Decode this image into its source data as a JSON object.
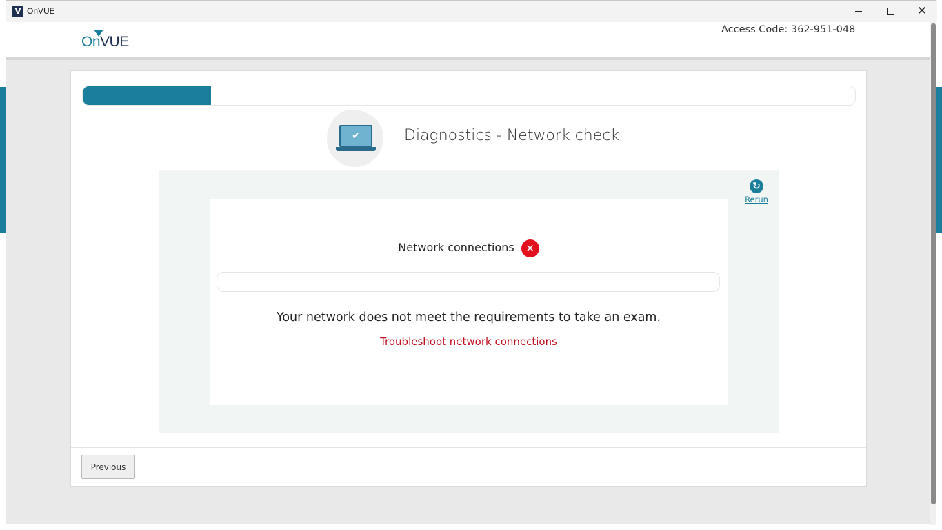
{
  "window": {
    "title": "OnVUE",
    "icon_letter": "V",
    "controls": [
      "minimize-icon",
      "maximize-icon",
      "close-icon"
    ],
    "close_glyph": "✕"
  },
  "header": {
    "logo_on": "On",
    "logo_vue": "VUE",
    "access_code": "Access Code: 362-951-048"
  },
  "progress": {
    "fraction": 0.166
  },
  "step": {
    "title": "Diagnostics - Network check",
    "icon": "laptop-check-icon"
  },
  "check": {
    "rerun_label": "Rerun",
    "label": "Network connections",
    "status": "failed",
    "status_glyph": "✕",
    "message": "Your network does not meet the requirements to take an exam.",
    "link_text": "Troubleshoot network connections"
  },
  "footer": {
    "previous_label": "Previous"
  },
  "colors": {
    "brand_teal": "#1b7f9c",
    "brand_navy": "#1e2f4f",
    "error_red": "#e2111d",
    "link_red": "#c0111e",
    "panel_bg": "#f1f6f5"
  }
}
